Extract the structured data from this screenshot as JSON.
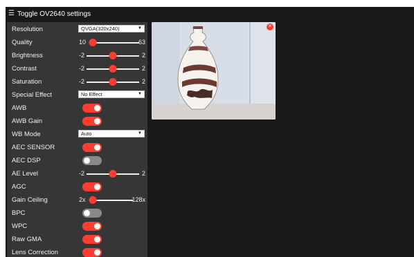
{
  "header": {
    "title": "Toggle OV2640 settings",
    "menu_icon": "hamburger-icon"
  },
  "settings": [
    {
      "label": "Resolution",
      "type": "select",
      "value": "QVGA(320x240)"
    },
    {
      "label": "Quality",
      "type": "slider",
      "min": "10",
      "max": "63",
      "value": 10
    },
    {
      "label": "Brightness",
      "type": "slider",
      "min": "-2",
      "max": "2",
      "value": 0
    },
    {
      "label": "Contrast",
      "type": "slider",
      "min": "-2",
      "max": "2",
      "value": 0
    },
    {
      "label": "Saturation",
      "type": "slider",
      "min": "-2",
      "max": "2",
      "value": 0
    },
    {
      "label": "Special Effect",
      "type": "select",
      "value": "No Effect"
    },
    {
      "label": "AWB",
      "type": "toggle",
      "on": true
    },
    {
      "label": "AWB Gain",
      "type": "toggle",
      "on": true
    },
    {
      "label": "WB Mode",
      "type": "select",
      "value": "Auto"
    },
    {
      "label": "AEC SENSOR",
      "type": "toggle",
      "on": true
    },
    {
      "label": "AEC DSP",
      "type": "toggle",
      "on": false
    },
    {
      "label": "AE Level",
      "type": "slider",
      "min": "-2",
      "max": "2",
      "value": 0
    },
    {
      "label": "AGC",
      "type": "toggle",
      "on": true
    },
    {
      "label": "Gain Ceiling",
      "type": "slider",
      "min": "2x",
      "max": "128x",
      "value": 0
    },
    {
      "label": "BPC",
      "type": "toggle",
      "on": false
    },
    {
      "label": "WPC",
      "type": "toggle",
      "on": true
    },
    {
      "label": "Raw GMA",
      "type": "toggle",
      "on": true
    },
    {
      "label": "Lens Correction",
      "type": "toggle",
      "on": true
    }
  ],
  "preview": {
    "close_icon": "close-icon",
    "accent": "#ff3d32"
  }
}
